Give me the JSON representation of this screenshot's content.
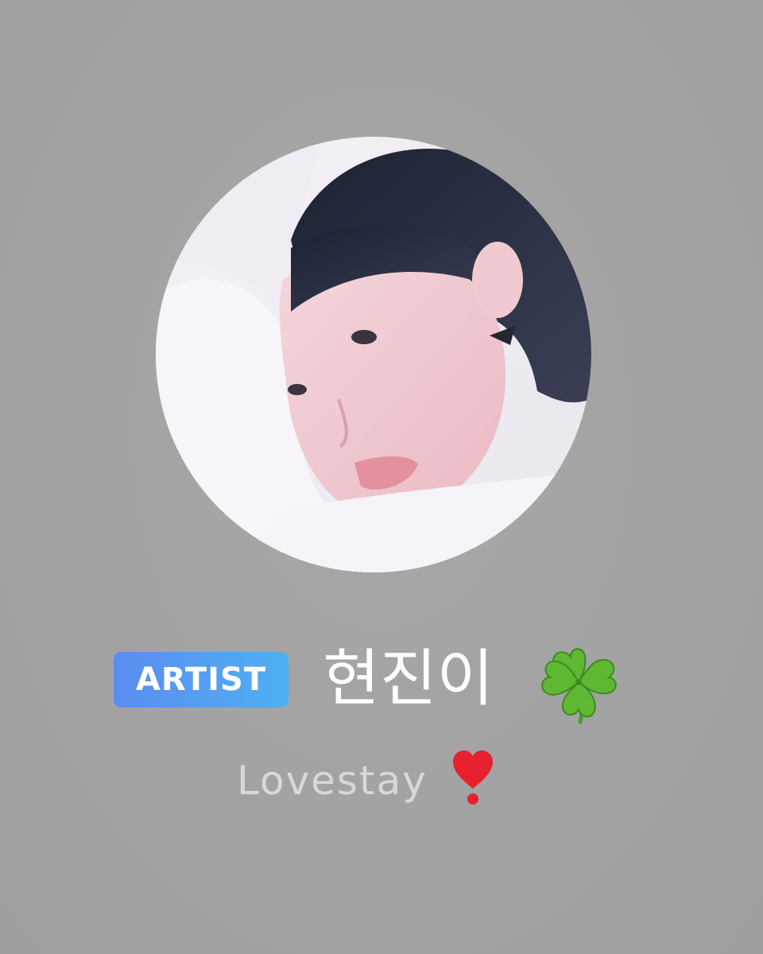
{
  "profile": {
    "badge_label": "ARTIST",
    "display_name": "현진이",
    "name_emoji_icon": "four-leaf-clover-icon",
    "status_text": "Lovestay",
    "status_emoji_icon": "heart-exclamation-icon"
  },
  "colors": {
    "background": "#a3a3a3",
    "badge_gradient_start": "#5b8cf0",
    "badge_gradient_end": "#4fb0f2",
    "name_text": "#ffffff",
    "status_text": "#d8d8d8"
  }
}
